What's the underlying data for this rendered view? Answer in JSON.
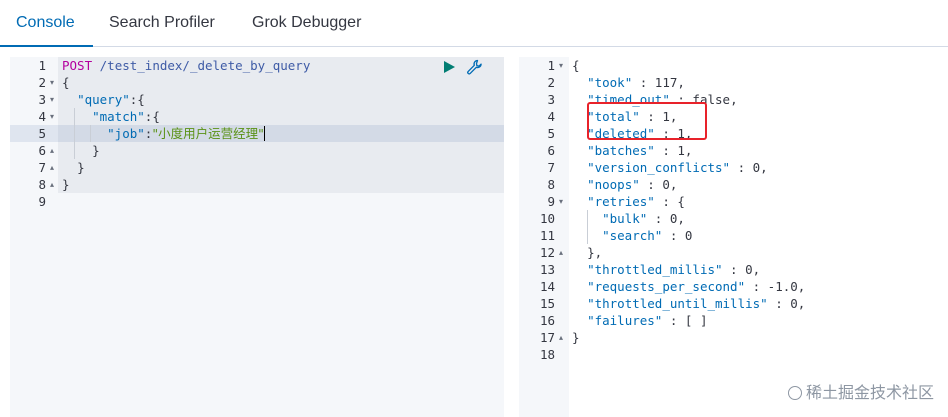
{
  "tabs": [
    {
      "label": "Console",
      "active": true
    },
    {
      "label": "Search Profiler",
      "active": false
    },
    {
      "label": "Grok Debugger",
      "active": false
    }
  ],
  "request": {
    "method": "POST",
    "path": "/test_index/_delete_by_query",
    "lines": [
      "1",
      "2",
      "3",
      "4",
      "5",
      "6",
      "7",
      "8",
      "9"
    ],
    "code": {
      "l2": "{",
      "l3_key": "\"query\"",
      "l3_rest": ":{",
      "l4_key": "\"match\"",
      "l4_rest": ":{",
      "l5_key": "\"job\"",
      "l5_colon": ":",
      "l5_val": "\"小度用户运营经理\"",
      "l6": "}",
      "l7": "}",
      "l8": "}"
    }
  },
  "response": {
    "lines": [
      "1",
      "2",
      "3",
      "4",
      "5",
      "6",
      "7",
      "8",
      "9",
      "10",
      "11",
      "12",
      "13",
      "14",
      "15",
      "16",
      "17",
      "18"
    ],
    "code": {
      "l1": "{",
      "l2_key": "\"took\"",
      "l2_val": " : 117,",
      "l3_key": "\"timed_out\"",
      "l3_val": " : false,",
      "l4_key": "\"total\"",
      "l4_val": " : 1,",
      "l5_key": "\"deleted\"",
      "l5_val": " : 1,",
      "l6_key": "\"batches\"",
      "l6_val": " : 1,",
      "l7_key": "\"version_conflicts\"",
      "l7_val": " : 0,",
      "l8_key": "\"noops\"",
      "l8_val": " : 0,",
      "l9_key": "\"retries\"",
      "l9_val": " : {",
      "l10_key": "\"bulk\"",
      "l10_val": " : 0,",
      "l11_key": "\"search\"",
      "l11_val": " : 0",
      "l12": "},",
      "l13_key": "\"throttled_millis\"",
      "l13_val": " : 0,",
      "l14_key": "\"requests_per_second\"",
      "l14_val": " : -1.0,",
      "l15_key": "\"throttled_until_millis\"",
      "l15_val": " : 0,",
      "l16_key": "\"failures\"",
      "l16_val": " : [ ]",
      "l17": "}"
    }
  },
  "watermark": "稀土掘金技术社区",
  "colors": {
    "accent": "#006bb4",
    "highlight": "#e8222a",
    "run": "#017d73"
  },
  "icons": {
    "run": "play-icon",
    "settings": "wrench-icon"
  }
}
